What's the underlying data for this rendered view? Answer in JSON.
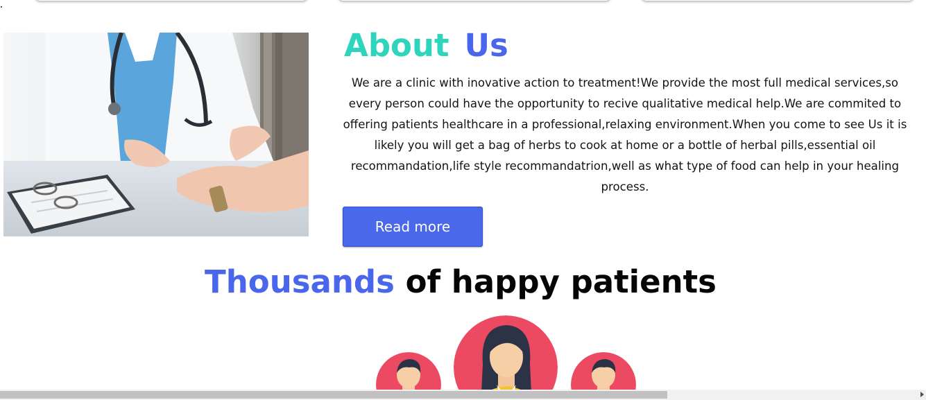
{
  "about": {
    "title_part1": "About",
    "title_part2": "Us",
    "paragraph": "We are a clinic with inovative action to treatment!We provide the most full medical services,so every person could have the opportunity to recive qualitative medical help.We are commited to offering patients healthcare in a professional,relaxing environment.When you come to see Us it is likely you will get a bag of herbs to cook at home or a bottle of herbal pills,essential oil recommandation,life style recommandatrion,well as what type of food can help in your healing process.",
    "button_label": "Read more"
  },
  "testimonials": {
    "title_highlight": "Thousands",
    "title_rest": "of happy patients"
  },
  "colors": {
    "teal": "#2fd4bd",
    "blue": "#4a66ea",
    "avatar_bg": "#ec4a63"
  },
  "icons": {
    "avatar_left": "male-avatar-icon",
    "avatar_center": "female-avatar-icon",
    "avatar_right": "male-avatar-icon"
  }
}
